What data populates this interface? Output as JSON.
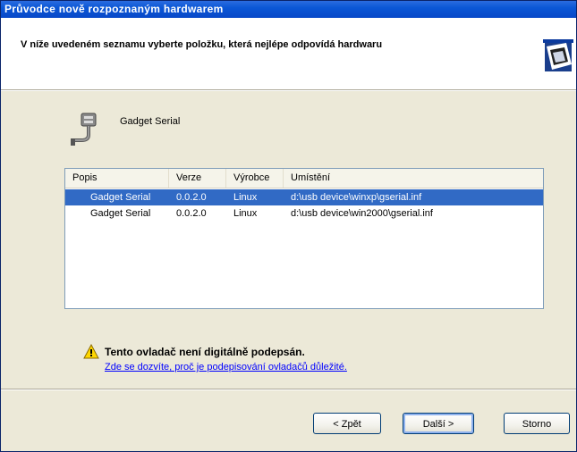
{
  "window": {
    "title": "Průvodce nově rozpoznaným hardwarem"
  },
  "header": {
    "instruction": "V níže uvedeném seznamu vyberte položku, která nejlépe odpovídá hardwaru"
  },
  "device": {
    "name": "Gadget Serial",
    "icon": "serial-port-icon"
  },
  "driver_list": {
    "columns": [
      "Popis",
      "Verze",
      "Výrobce",
      "Umístění"
    ],
    "rows": [
      {
        "description": "Gadget Serial",
        "version": "0.0.2.0",
        "manufacturer": "Linux",
        "location": "d:\\usb device\\winxp\\gserial.inf",
        "selected": true
      },
      {
        "description": "Gadget Serial",
        "version": "0.0.2.0",
        "manufacturer": "Linux",
        "location": "d:\\usb device\\win2000\\gserial.inf",
        "selected": false
      }
    ]
  },
  "warning": {
    "icon": "warning-icon",
    "title": "Tento ovladač není digitálně podepsán.",
    "link": "Zde se dozvíte, proč je podepisování ovladačů důležité."
  },
  "buttons": {
    "back": "< Zpět",
    "next": "Další >",
    "cancel": "Storno"
  },
  "colors": {
    "title_bar": "#0B57D6",
    "selection": "#316AC5",
    "link": "#0000FF",
    "dialog_bg": "#ECE9D8"
  }
}
